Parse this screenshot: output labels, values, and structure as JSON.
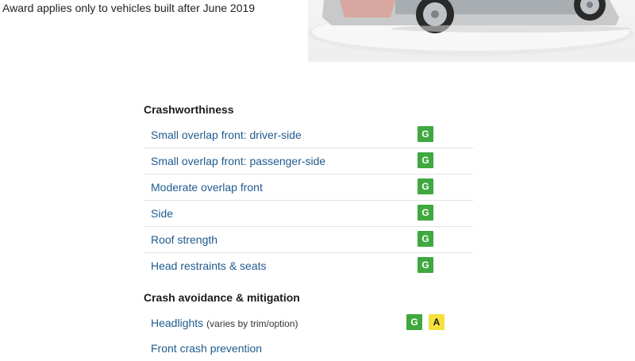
{
  "award_note": "Award applies only to vehicles built after June 2019",
  "colors": {
    "link": "#1f5b8f",
    "good": "#3fa83f",
    "acceptable": "#f4e13b",
    "divider": "#e3e3e3"
  },
  "crashworthiness": {
    "title": "Crashworthiness",
    "rows": [
      {
        "label": "Small overlap front: driver-side",
        "rating": "G"
      },
      {
        "label": "Small overlap front: passenger-side",
        "rating": "G"
      },
      {
        "label": "Moderate overlap front",
        "rating": "G"
      },
      {
        "label": "Side",
        "rating": "G"
      },
      {
        "label": "Roof strength",
        "rating": "G"
      },
      {
        "label": "Head restraints & seats",
        "rating": "G"
      }
    ]
  },
  "crash_avoidance": {
    "title": "Crash avoidance & mitigation",
    "rows": [
      {
        "label": "Headlights",
        "note": "(varies by trim/option)",
        "ratings": [
          "G",
          "A"
        ]
      },
      {
        "label": "Front crash prevention"
      }
    ]
  }
}
